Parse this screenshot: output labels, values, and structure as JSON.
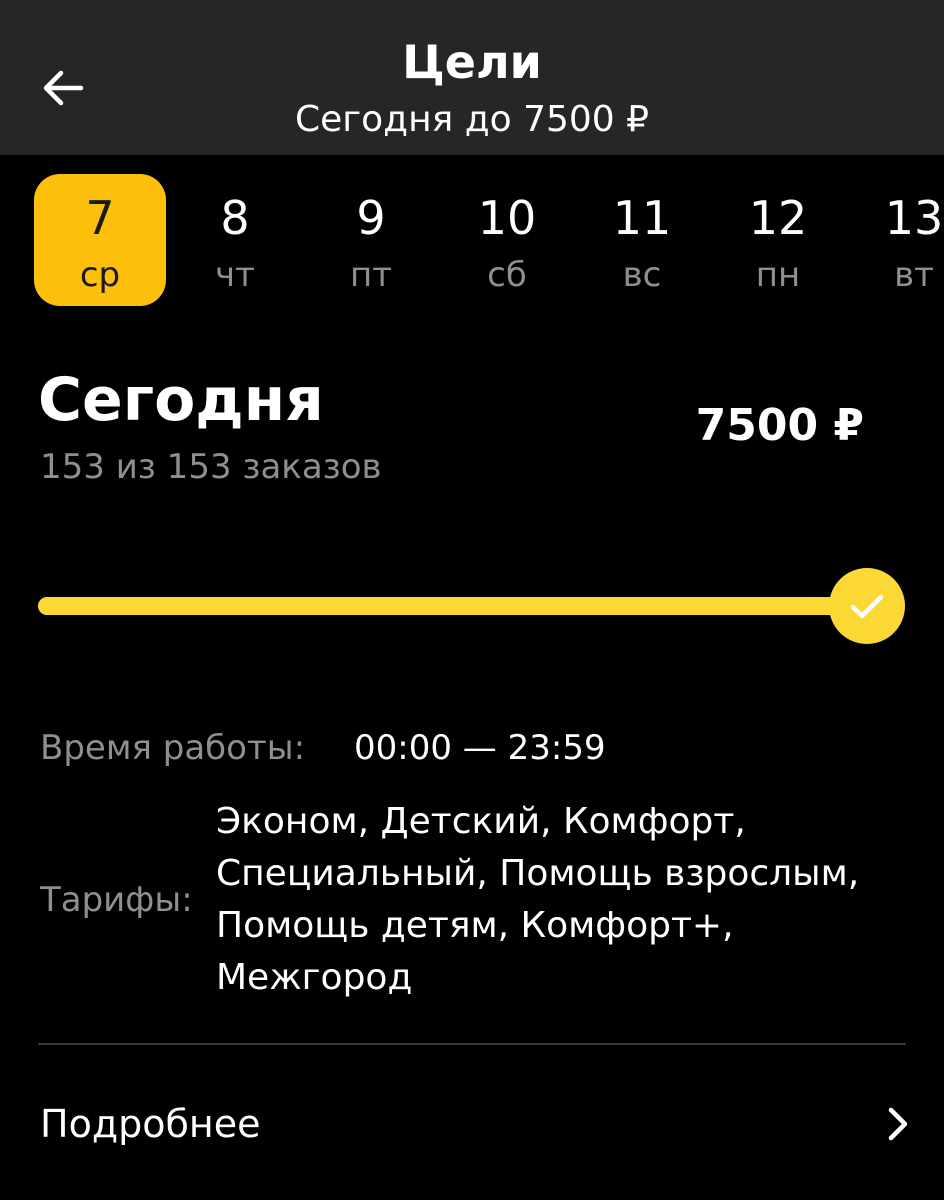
{
  "header": {
    "title": "Цели",
    "subtitle": "Сегодня до 7500 ₽"
  },
  "days": [
    {
      "num": "7",
      "weekday": "ср",
      "active": true
    },
    {
      "num": "8",
      "weekday": "чт"
    },
    {
      "num": "9",
      "weekday": "пт"
    },
    {
      "num": "10",
      "weekday": "сб"
    },
    {
      "num": "11",
      "weekday": "вс"
    },
    {
      "num": "12",
      "weekday": "пн"
    },
    {
      "num": "13",
      "weekday": "вт"
    }
  ],
  "goal": {
    "title": "Сегодня",
    "orders": "153 из 153 заказов",
    "amount": "7500 ₽",
    "progress": 1.0,
    "completed": true
  },
  "details": {
    "work_time_label": "Время работы:",
    "work_time_value": "00:00 — 23:59",
    "tariffs_label": "Тарифы:",
    "tariffs_lines": [
      "Эконом, Детский, Комфорт,",
      "Специальный, Помощь взрослым,",
      "Помощь детям, Комфорт+,",
      "Межгород"
    ]
  },
  "more": {
    "label": "Подробнее"
  },
  "colors": {
    "accent": "#fcc00c",
    "progress": "#fcd835",
    "header_bg": "#262626",
    "background": "#000000",
    "secondary_text": "#8f8f8f"
  },
  "icons": {
    "back": "arrow-left-icon",
    "check": "check-icon",
    "more": "chevron-right-icon"
  }
}
